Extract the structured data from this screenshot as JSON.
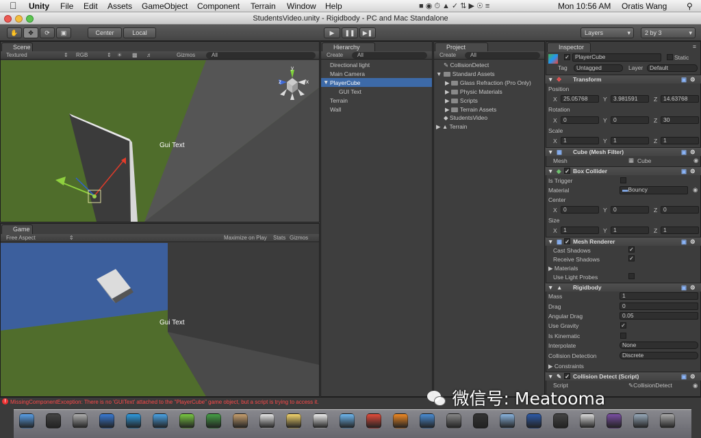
{
  "menubar": {
    "apple": "",
    "items": [
      "Unity",
      "File",
      "Edit",
      "Assets",
      "GameObject",
      "Component",
      "Terrain",
      "Window",
      "Help"
    ],
    "clock": "Mon 10:56 AM",
    "user": "Oratis Wang"
  },
  "window_title": "StudentsVideo.unity - Rigidbody - PC and Mac Standalone",
  "toolbar": {
    "center": "Center",
    "local": "Local",
    "layers": "Layers",
    "layout": "2 by 3"
  },
  "scene": {
    "tab": "Scene",
    "textured": "Textured",
    "rgb": "RGB",
    "gizmos": "Gizmos",
    "search": "All",
    "gui_text": "Gui Text",
    "axis_x": "x",
    "axis_y": "y",
    "axis_z": "z"
  },
  "game": {
    "tab": "Game",
    "aspect": "Free Aspect",
    "maximize": "Maximize on Play",
    "stats": "Stats",
    "gizmos": "Gizmos",
    "gui_text": "Gui Text"
  },
  "hierarchy": {
    "tab": "Hierarchy",
    "create": "Create",
    "search": "All",
    "items": [
      "Directional light",
      "Main Camera",
      "PlayerCube",
      "GUI Text",
      "Terrain",
      "Wall"
    ]
  },
  "project": {
    "tab": "Project",
    "create": "Create",
    "search": "All",
    "items": [
      "CollisionDetect",
      "Standard Assets",
      "Glass Refraction (Pro Only)",
      "Physic Materials",
      "Scripts",
      "Terrain Assets",
      "StudentsVideo",
      "Terrain"
    ]
  },
  "inspector": {
    "tab": "Inspector",
    "object_name": "PlayerCube",
    "static": "Static",
    "tag_label": "Tag",
    "tag": "Untagged",
    "layer_label": "Layer",
    "layer": "Default",
    "transform": {
      "title": "Transform",
      "position": "Position",
      "px": "25.05768",
      "py": "3.981591",
      "pz": "14.63768",
      "rotation": "Rotation",
      "rx": "0",
      "ry": "0",
      "rz": "30",
      "scale": "Scale",
      "sx": "1",
      "sy": "1",
      "sz": "1"
    },
    "mesh_filter": {
      "title": "Cube (Mesh Filter)",
      "mesh_label": "Mesh",
      "mesh": "Cube"
    },
    "box_collider": {
      "title": "Box Collider",
      "is_trigger": "Is Trigger",
      "material_label": "Material",
      "material": "Bouncy",
      "center": "Center",
      "cx": "0",
      "cy": "0",
      "cz": "0",
      "size": "Size",
      "sx": "1",
      "sy": "1",
      "sz": "1"
    },
    "mesh_renderer": {
      "title": "Mesh Renderer",
      "cast_shadows": "Cast Shadows",
      "receive_shadows": "Receive Shadows",
      "materials": "Materials",
      "light_probes": "Use Light Probes"
    },
    "rigidbody": {
      "title": "Rigidbody",
      "mass_label": "Mass",
      "mass": "1",
      "drag_label": "Drag",
      "drag": "0",
      "angular_label": "Angular Drag",
      "angular": "0.05",
      "gravity": "Use Gravity",
      "kinematic": "Is Kinematic",
      "interp_label": "Interpolate",
      "interp": "None",
      "collision_label": "Collision Detection",
      "collision": "Discrete",
      "constraints": "Constraints"
    },
    "collision_script": {
      "title": "Collision Detect (Script)",
      "script_label": "Script",
      "script": "CollisionDetect"
    },
    "axis": {
      "x": "X",
      "y": "Y",
      "z": "Z"
    }
  },
  "status": {
    "error": "MissingComponentException: There is no 'GUIText' attached to the \"PlayerCube\" game object, but a script is trying to access it."
  },
  "watermark": "微信号: Meatooma",
  "colors": {
    "selection": "#3d6aa8",
    "error": "#ff4a4a",
    "sky": "#3b5f9e",
    "grass": "#4d6b2a"
  },
  "dock": {
    "icons": [
      "finder",
      "dashboard",
      "launchpad",
      "mission-control",
      "app-store",
      "safari",
      "messages",
      "facetime",
      "contacts",
      "calendar",
      "notes",
      "reminders",
      "itunes",
      "chrome",
      "firefox",
      "xcode",
      "instruments",
      "terminal",
      "preview",
      "photoshop",
      "unity",
      "textedit",
      "monodevelop",
      "folders",
      "trash"
    ]
  }
}
